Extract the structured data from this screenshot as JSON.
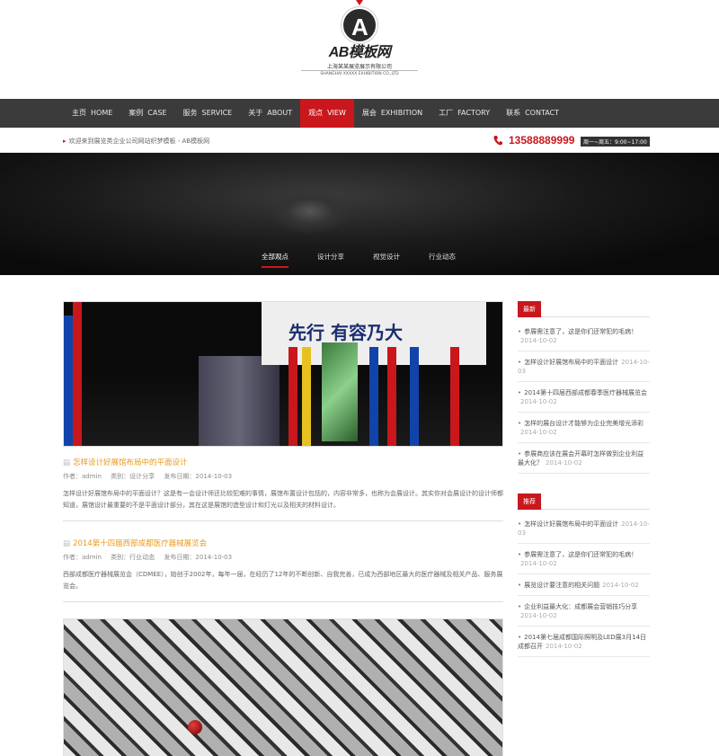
{
  "logo": {
    "letter": "A",
    "title": "AB模板网",
    "company_cn": "上海某某展览展示有限公司",
    "company_en": "SHANGHAI XXXXX EXHIBITION CO.,LTD"
  },
  "nav": {
    "items": [
      {
        "cn": "主页",
        "en": "HOME"
      },
      {
        "cn": "案例",
        "en": "CASE"
      },
      {
        "cn": "服务",
        "en": "SERVICE"
      },
      {
        "cn": "关于",
        "en": "ABOUT"
      },
      {
        "cn": "观点",
        "en": "VIEW"
      },
      {
        "cn": "展会",
        "en": "EXHIBITION"
      },
      {
        "cn": "工厂",
        "en": "FACTORY"
      },
      {
        "cn": "联系",
        "en": "CONTACT"
      }
    ]
  },
  "welcome": {
    "message": "欢迎来到展览类企业公司网站织梦模板 - AB模板网",
    "phone": "13588889999",
    "hours": "周一~周五：9:00~17:00"
  },
  "banner": {
    "tabs": [
      "全部观点",
      "设计分享",
      "视觉设计",
      "行业动态"
    ]
  },
  "booth_text": "先行 有容乃大",
  "posts": [
    {
      "title": "怎样设计好展馆布局中的平面设计",
      "author": "作者：admin",
      "category": "类别：设计分享",
      "date": "发布日期：2014-10-03",
      "desc": "怎样设计好展馆布局中的平面设计？这是有一会设计师还比较犯难的事情，展馆布置设计包括的，内容非常多，也称为会展设计。其实你对会展设计的设计师都知道，展馆设计最重要的不是平面设计部分，其在这是展馆的造型设计和灯光以及相关的材料设计。"
    },
    {
      "title": "2014第十四届西部成都医疗器械展览会",
      "author": "作者：admin",
      "category": "类别：行业动态",
      "date": "发布日期：2014-10-03",
      "desc": "西部成都医疗器械展览会（CDMEE），始创于2002年，每年一届，在经历了12年的不断创新、自我完善，已成为西部地区最大的医疗器械及相关产品、服务展览会。"
    }
  ],
  "sidebar": {
    "latest_title": "最新",
    "latest": [
      {
        "text": "参展需注意了，这是你们还常犯的毛病！",
        "date": "2014-10-02"
      },
      {
        "text": "怎样设计好展馆布局中的平面设计",
        "date": "2014-10-03"
      },
      {
        "text": "2014第十四届西部成都春季医疗器械展览会",
        "date": "2014-10-02"
      },
      {
        "text": "怎样的展台设计才能够为企业完美增光添彩",
        "date": "2014-10-02"
      },
      {
        "text": "参展商应该在展会开幕时怎样做到企业利益最大化？",
        "date": "2014-10-02"
      }
    ],
    "rec_title": "推荐",
    "recommended": [
      {
        "text": "怎样设计好展馆布局中的平面设计",
        "date": "2014-10-03"
      },
      {
        "text": "参展需注意了，这是你们还常犯的毛病！",
        "date": "2014-10-02"
      },
      {
        "text": "展览设计要注意的相关问题",
        "date": "2014-10-02"
      },
      {
        "text": "企业利益最大化：成都展会营销技巧分享",
        "date": "2014-10-02"
      },
      {
        "text": "2014第七届成都国际照明及LED展3月14日成都召开",
        "date": "2014-10-02"
      }
    ]
  },
  "colors": {
    "accent": "#c9171c",
    "nav_bg": "#3b3b3b",
    "title_orange": "#e89a1e"
  }
}
